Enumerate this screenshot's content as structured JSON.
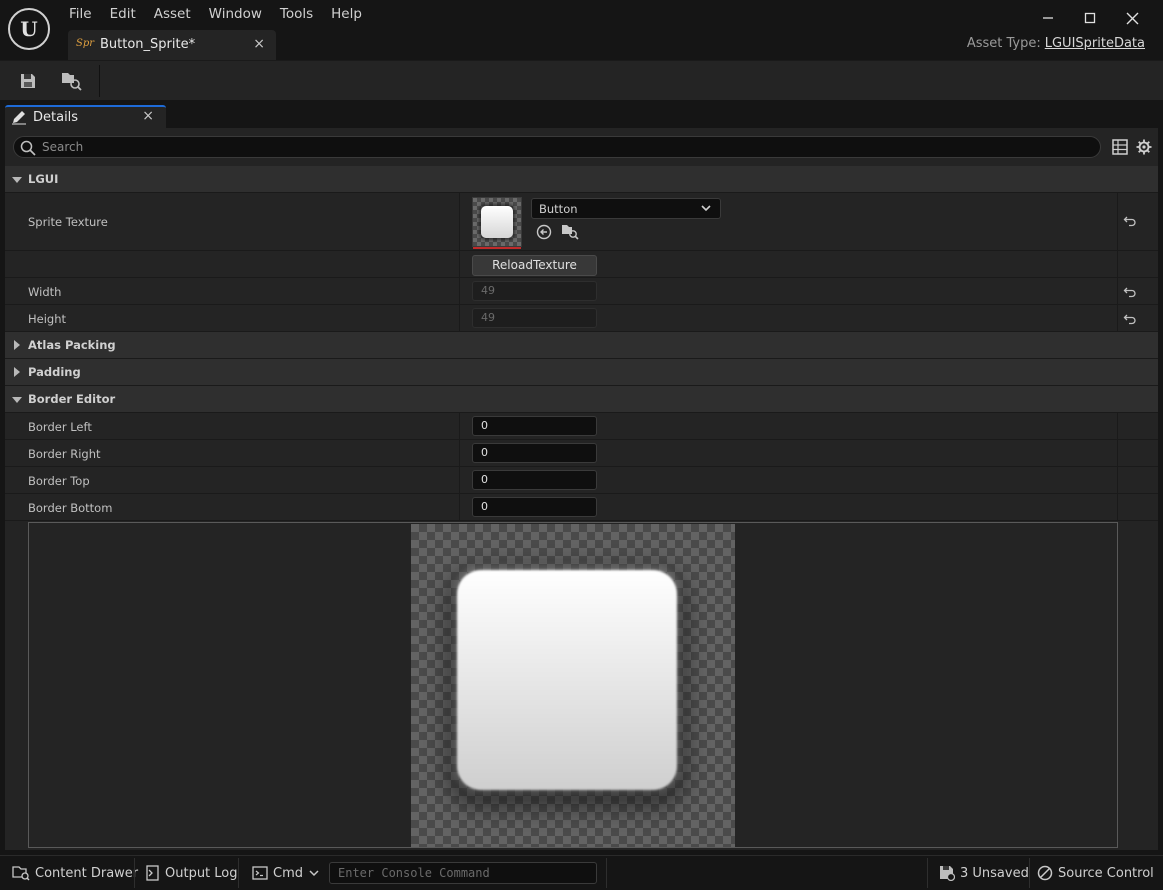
{
  "app": {
    "logo_letter": "U",
    "menu": [
      "File",
      "Edit",
      "Asset",
      "Window",
      "Tools",
      "Help"
    ],
    "document_tab": {
      "type_badge": "Spr",
      "title": "Button_Sprite*",
      "close": "×"
    },
    "asset_type_label": "Asset Type:",
    "asset_type_value": "LGUISpriteData"
  },
  "details": {
    "tab_label": "Details",
    "tab_close": "×",
    "search_placeholder": "Search",
    "categories": {
      "lgui": "LGUI",
      "atlas_packing": "Atlas Packing",
      "padding": "Padding",
      "border_editor": "Border Editor"
    },
    "sprite_texture": {
      "label": "Sprite Texture",
      "asset_name": "Button"
    },
    "reload_button": "ReloadTexture",
    "width": {
      "label": "Width",
      "value": "49"
    },
    "height": {
      "label": "Height",
      "value": "49"
    },
    "border_left": {
      "label": "Border Left",
      "value": "0"
    },
    "border_right": {
      "label": "Border Right",
      "value": "0"
    },
    "border_top": {
      "label": "Border Top",
      "value": "0"
    },
    "border_bottom": {
      "label": "Border Bottom",
      "value": "0"
    }
  },
  "statusbar": {
    "content_drawer": "Content Drawer",
    "output_log": "Output Log",
    "cmd": "Cmd",
    "console_placeholder": "Enter Console Command",
    "unsaved": "3 Unsaved",
    "source_control": "Source Control"
  },
  "colors": {
    "accent": "#1e6bd8",
    "thumb_underline": "#c02a2a",
    "badge": "#e0a040"
  },
  "icons": [
    "save-icon",
    "browse-asset-icon",
    "pencil-icon",
    "search-icon",
    "table-view-icon",
    "gear-icon",
    "reset-arrow-icon",
    "chevron-down-icon",
    "use-selected-icon",
    "browse-icon",
    "minimize-icon",
    "maximize-icon",
    "close-icon",
    "content-drawer-icon",
    "output-log-icon",
    "cmd-icon",
    "unsaved-icon",
    "source-control-icon"
  ]
}
